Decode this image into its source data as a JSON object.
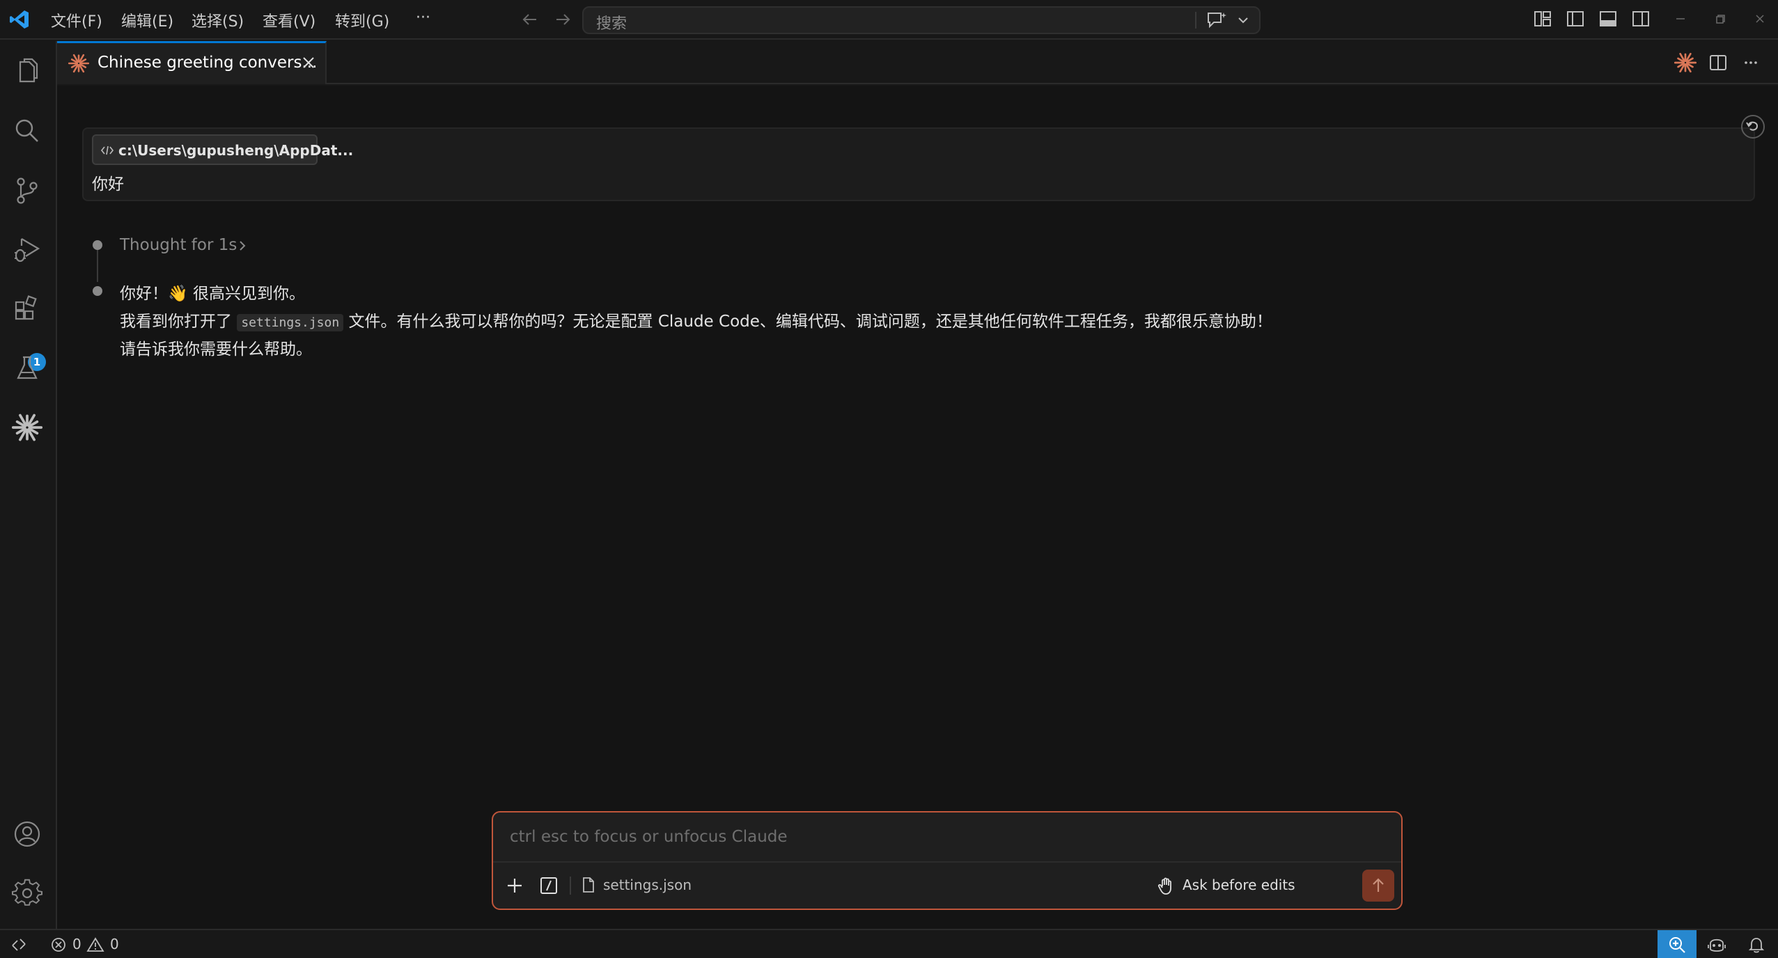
{
  "titlebar": {
    "menu": [
      "文件(F)",
      "编辑(E)",
      "选择(S)",
      "查看(V)",
      "转到(G)",
      "···"
    ],
    "search_placeholder": "搜索"
  },
  "activitybar": {
    "extensions_badge": "1"
  },
  "tab": {
    "title": "Chinese greeting convers..."
  },
  "conversation": {
    "context_file": "c:\\Users\\gupusheng\\AppDat...",
    "user_message": "你好",
    "thought_label": "Thought for 1s",
    "reply": {
      "line1": "你好！👋 很高兴见到你。",
      "line2_prefix": "我看到你打开了 ",
      "line2_code": "settings.json",
      "line2_suffix": " 文件。有什么我可以帮你的吗？无论是配置 Claude Code、编辑代码、调试问题，还是其他任何软件工程任务，我都很乐意协助！",
      "line3": "请告诉我你需要什么帮助。"
    }
  },
  "input": {
    "placeholder": "ctrl esc to focus or unfocus Claude",
    "context_file": "settings.json",
    "mode_label": "Ask before edits",
    "border_color": "#c0563b",
    "send_color": "#7a3624"
  },
  "statusbar": {
    "errors": "0",
    "warnings": "0"
  },
  "colors": {
    "claude_accent": "#d97757",
    "vscode_blue": "#0078d4",
    "badge_blue": "#1e8ad6"
  }
}
